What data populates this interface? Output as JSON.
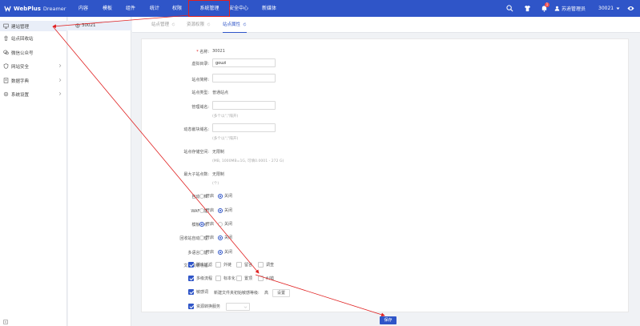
{
  "header": {
    "logo_text": "WebPlus",
    "logo_sub": "Dreamer",
    "nav": [
      "内容",
      "模板",
      "组件",
      "统计",
      "权限",
      "系统管理",
      "安全中心",
      "新媒体"
    ],
    "notification_count": "1",
    "user_name": "苏迪管理员",
    "site_id": "30021"
  },
  "sidebar": {
    "items": [
      {
        "label": "建站管理"
      },
      {
        "label": "站点回收站"
      },
      {
        "label": "微信公众号"
      },
      {
        "label": "网站安全"
      },
      {
        "label": "数据字典"
      },
      {
        "label": "系统设置"
      }
    ]
  },
  "tree": {
    "node": "30021"
  },
  "tabs": [
    "站点管理",
    "资源权限",
    "站点属性"
  ],
  "form": {
    "name_label": "名称:",
    "name_value": "30021",
    "vdir_label": "虚拟目录:",
    "vdir_value": "gouzi",
    "alias_label": "站点简称:",
    "alias_value": "",
    "type_label": "站点类型:",
    "type_value": "普通站点",
    "domain_label": "管理域名:",
    "domain_value": "",
    "domain_hint": "(多个以\",\"隔开)",
    "dyn_domain_label": "动态嵌块域名:",
    "dyn_domain_value": "",
    "dyn_domain_hint": "(多个以\",\"隔开)",
    "storage_label": "站点存储空间:",
    "storage_value": "无限制",
    "storage_hint": "(MB, 1000MB=1G, 可填0.0001 - 272 G)",
    "max_sub_label": "最大子站点数:",
    "max_sub_value": "无限制",
    "max_sub_hint": "(个)",
    "radios": [
      {
        "label": "自动归档:",
        "options": [
          "开启",
          "关闭"
        ],
        "selected": "关闭"
      },
      {
        "label": "WAF功能:",
        "options": [
          "开启",
          "关闭"
        ],
        "selected": "关闭"
      },
      {
        "label": "模板站点:",
        "options": [
          "开启",
          "关闭"
        ],
        "selected": "开启"
      },
      {
        "label": "回收站自动清理:",
        "options": [
          "开启",
          "关闭"
        ],
        "selected": "关闭"
      },
      {
        "label": "多语言功能:",
        "options": [
          "开启",
          "关闭"
        ],
        "selected": "关闭"
      }
    ],
    "advanced_label": "文档高级功能:",
    "advanced_row1": [
      {
        "label": "脚本过滤",
        "checked": true
      },
      {
        "label": "外链",
        "checked": false
      },
      {
        "label": "留言",
        "checked": false
      },
      {
        "label": "调查",
        "checked": false
      }
    ],
    "advanced_row2": [
      {
        "label": "多级流程",
        "checked": true
      },
      {
        "label": "标本化",
        "checked": false
      },
      {
        "label": "置顶",
        "checked": false
      },
      {
        "label": "纠错",
        "checked": false
      }
    ],
    "sensitive_label": "敏感词",
    "sensitive_checked": true,
    "sensitive_level_text": "新建文件夹初始敏感等级:",
    "sensitive_level_value": "高",
    "setting_button": "设置",
    "resource_label": "资源转换服务",
    "resource_checked": true,
    "resource_select": ""
  },
  "save_button": "保存",
  "colors": {
    "primary": "#2f55c8",
    "annotation": "#e02020"
  }
}
